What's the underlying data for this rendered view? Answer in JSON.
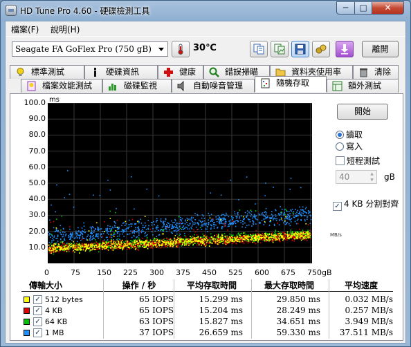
{
  "window": {
    "title": "HD Tune Pro 4.60 - 硬碟檢測工具",
    "minimize": "─",
    "maximize": "□",
    "close": "✕"
  },
  "menu": {
    "file": "檔案(F)",
    "help": "說明(H)"
  },
  "toolbar": {
    "drive": "Seagate FA GoFlex Pro    (750 gB)",
    "temperature": "30℃",
    "exit": "離開",
    "icons": [
      "copy-text-icon",
      "copy-image-icon",
      "save-icon",
      "options-icon",
      "download-icon"
    ]
  },
  "tabs_row1": [
    "標準測試",
    "硬碟資訊",
    "健康",
    "錯誤掃瞄",
    "資料夾使用率",
    "清除"
  ],
  "tabs_row2": [
    "檔案效能測試",
    "磁碟監視",
    "自動噪音管理",
    "隨機存取",
    "額外測試"
  ],
  "active_tab": "隨機存取",
  "controls": {
    "start": "開始",
    "read": "讀取",
    "write": "寫入",
    "short_test": "短程測試",
    "size_value": "40",
    "size_unit": "gB",
    "align_4k": "4 KB 分割對齊",
    "read_selected": true,
    "write_selected": false,
    "short_test_checked": false,
    "align_checked": true
  },
  "chart_data": {
    "type": "scatter",
    "ylabel": "ms",
    "xunit": "gB",
    "ylim": [
      0,
      100
    ],
    "xlim": [
      0,
      750
    ],
    "yticks": [
      "100.0",
      "90.0",
      "80.0",
      "70.0",
      "60.0",
      "50.0",
      "40.0",
      "30.0",
      "20.0",
      "10.0"
    ],
    "xticks": [
      "0",
      "75",
      "150",
      "225",
      "300",
      "375",
      "450",
      "525",
      "600",
      "675",
      "750gB"
    ],
    "right_label": "MB/s",
    "series": [
      {
        "name": "512 bytes",
        "color": "#ffff00",
        "mean_ms": 15.299,
        "max_ms": 29.85
      },
      {
        "name": "4 KB",
        "color": "#e00000",
        "mean_ms": 15.204,
        "max_ms": 28.249
      },
      {
        "name": "64 KB",
        "color": "#00d000",
        "mean_ms": 15.827,
        "max_ms": 34.651
      },
      {
        "name": "1 MB",
        "color": "#2090ff",
        "mean_ms": 26.659,
        "max_ms": 59.33
      }
    ]
  },
  "results": {
    "headers": [
      "傳輸大小",
      "操作 / 秒",
      "平均存取時間",
      "最大存取時間",
      "平均速度"
    ],
    "rows": [
      {
        "label": "512 bytes",
        "color": "#ffff00",
        "ops": "65 IOPS",
        "avg": "15.299 ms",
        "max": "29.850 ms",
        "speed": "0.032 MB/s"
      },
      {
        "label": "4 KB",
        "color": "#e00000",
        "ops": "65 IOPS",
        "avg": "15.204 ms",
        "max": "28.249 ms",
        "speed": "0.257 MB/s"
      },
      {
        "label": "64 KB",
        "color": "#00c000",
        "ops": "63 IOPS",
        "avg": "15.827 ms",
        "max": "34.651 ms",
        "speed": "3.949 MB/s"
      },
      {
        "label": "1 MB",
        "color": "#1e90ff",
        "ops": "37 IOPS",
        "avg": "26.659 ms",
        "max": "59.330 ms",
        "speed": "37.511 MB/s"
      }
    ]
  }
}
